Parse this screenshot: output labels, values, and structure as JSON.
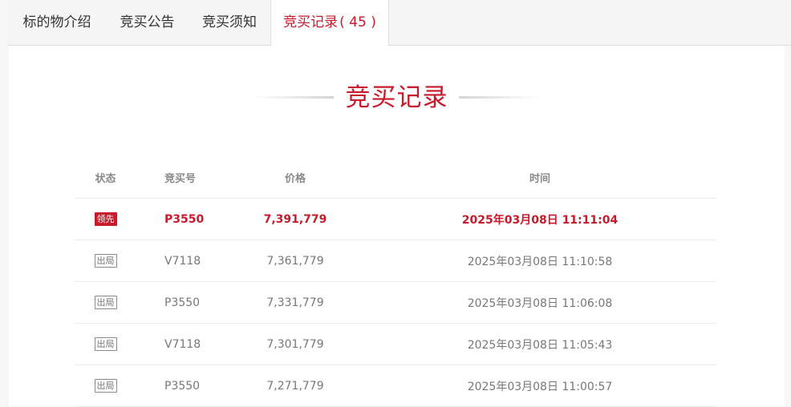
{
  "tabs": [
    {
      "label": "标的物介绍"
    },
    {
      "label": "竞买公告"
    },
    {
      "label": "竞买须知"
    },
    {
      "label": "竞买记录",
      "count": "( 45 )",
      "active": true
    }
  ],
  "section_title": "竞买记录",
  "table": {
    "headers": {
      "status": "状态",
      "bid_no": "竞买号",
      "price": "价格",
      "time": "时间"
    },
    "rows": [
      {
        "status": "领先",
        "bid_no": "P3550",
        "price": "7,391,779",
        "time": "2025年03月08日 11:11:04"
      },
      {
        "status": "出局",
        "bid_no": "V7118",
        "price": "7,361,779",
        "time": "2025年03月08日 11:10:58"
      },
      {
        "status": "出局",
        "bid_no": "P3550",
        "price": "7,331,779",
        "time": "2025年03月08日 11:06:08"
      },
      {
        "status": "出局",
        "bid_no": "V7118",
        "price": "7,301,779",
        "time": "2025年03月08日 11:05:43"
      },
      {
        "status": "出局",
        "bid_no": "P3550",
        "price": "7,271,779",
        "time": "2025年03月08日 11:00:57"
      }
    ]
  },
  "colors": {
    "accent": "#c81a2a",
    "text_muted": "#777777",
    "divider": "#ebebeb"
  }
}
